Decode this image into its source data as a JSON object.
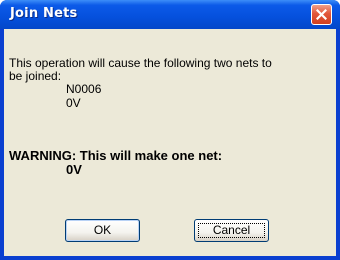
{
  "window": {
    "title": "Join Nets",
    "close_icon": "close-icon"
  },
  "message": {
    "line1": "This operation will cause the following two nets to",
    "line2": "be joined:",
    "net1": "N0006",
    "net2": "0V"
  },
  "warning": {
    "text": "WARNING: This will make one net:",
    "result_net": "0V"
  },
  "buttons": {
    "ok_label": "OK",
    "cancel_label": "Cancel"
  },
  "colors": {
    "titlebar": "#0550dc",
    "client_background": "#ece9d8",
    "close_button": "#e2573b"
  }
}
